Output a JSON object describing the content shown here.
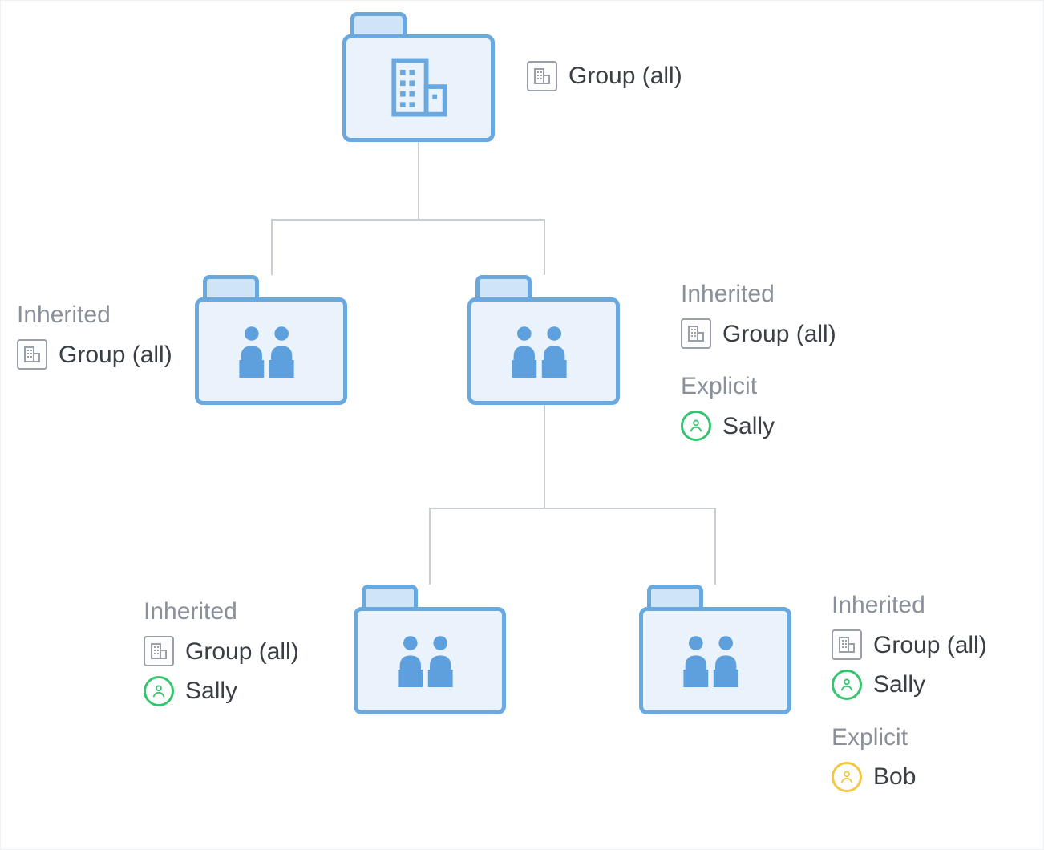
{
  "labels": {
    "inherited": "Inherited",
    "explicit": "Explicit",
    "group_all": "Group (all)",
    "sally": "Sally",
    "bob": "Bob"
  },
  "colors": {
    "folder_border": "#6aa9e0",
    "folder_fill": "#eaf3fc",
    "folder_tab_fill": "#cfe4f7",
    "text_muted": "#8a9099",
    "text": "#3a3f45",
    "connector": "#c9ced4",
    "ring_green": "#36c46f",
    "ring_yellow": "#f2c744",
    "icon_grey": "#9aa0a8"
  },
  "tree": {
    "root": {
      "icon": "company-building",
      "right_panel": {
        "rows": [
          {
            "icon": "company-icon",
            "text_key": "group_all"
          }
        ]
      },
      "children": [
        {
          "icon": "people",
          "left_panel": {
            "sections": [
              {
                "title_key": "inherited",
                "rows": [
                  {
                    "icon": "company-icon",
                    "text_key": "group_all"
                  }
                ]
              }
            ]
          }
        },
        {
          "icon": "people",
          "right_panel": {
            "sections": [
              {
                "title_key": "inherited",
                "rows": [
                  {
                    "icon": "company-icon",
                    "text_key": "group_all"
                  }
                ]
              },
              {
                "title_key": "explicit",
                "rows": [
                  {
                    "icon": "user-green",
                    "text_key": "sally"
                  }
                ]
              }
            ]
          },
          "children": [
            {
              "icon": "people",
              "left_panel": {
                "sections": [
                  {
                    "title_key": "inherited",
                    "rows": [
                      {
                        "icon": "company-icon",
                        "text_key": "group_all"
                      },
                      {
                        "icon": "user-green",
                        "text_key": "sally"
                      }
                    ]
                  }
                ]
              }
            },
            {
              "icon": "people",
              "right_panel": {
                "sections": [
                  {
                    "title_key": "inherited",
                    "rows": [
                      {
                        "icon": "company-icon",
                        "text_key": "group_all"
                      },
                      {
                        "icon": "user-green",
                        "text_key": "sally"
                      }
                    ]
                  },
                  {
                    "title_key": "explicit",
                    "rows": [
                      {
                        "icon": "user-yellow",
                        "text_key": "bob"
                      }
                    ]
                  }
                ]
              }
            }
          ]
        }
      ]
    }
  }
}
